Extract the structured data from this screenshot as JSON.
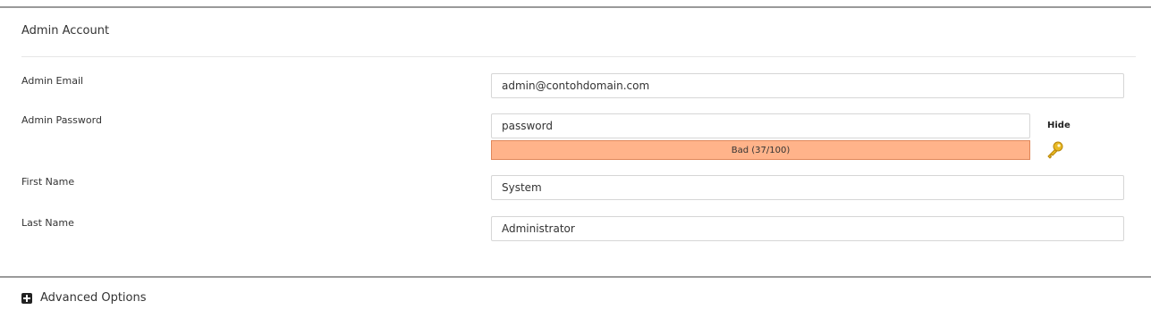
{
  "section": {
    "title": "Admin Account"
  },
  "fields": {
    "email": {
      "label": "Admin Email",
      "value": "admin@contohdomain.com"
    },
    "password": {
      "label": "Admin Password",
      "value": "password",
      "strength_text": "Bad (37/100)",
      "strength_score": 37,
      "strength_max": 100,
      "toggle_label": "Hide",
      "generate_icon": "key-icon"
    },
    "first_name": {
      "label": "First Name",
      "value": "System"
    },
    "last_name": {
      "label": "Last Name",
      "value": "Administrator"
    }
  },
  "advanced": {
    "label": "Advanced Options",
    "icon": "plus-square-icon"
  },
  "colors": {
    "strength_bad_fill": "#ffb38a",
    "strength_bad_border": "#e0875a",
    "key_gold": "#d4a017",
    "rule": "#9a9a9a"
  }
}
